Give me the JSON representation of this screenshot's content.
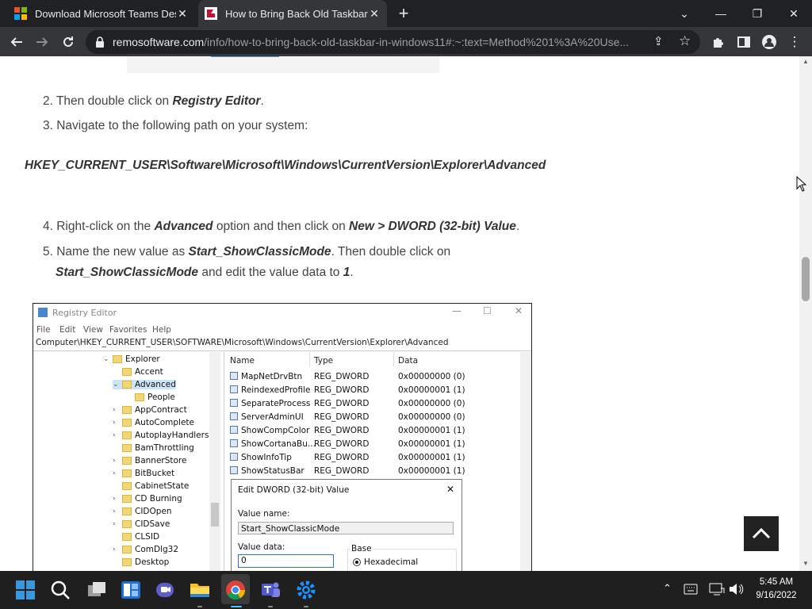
{
  "tabs": [
    {
      "title": "Download Microsoft Teams Desktop",
      "close": "✕"
    },
    {
      "title": "How to Bring Back Old Taskbar in Windows 11",
      "close": "✕"
    }
  ],
  "new_tab": "+",
  "window": {
    "minimize": "—",
    "restore": "❐",
    "close": "✕",
    "tab_search": "⌄"
  },
  "omnibox": {
    "host": "remosoftware.com",
    "path": "/info/how-to-bring-back-old-taskbar-in-windows11#:~:text=Method%201%3A%20Use..."
  },
  "article": {
    "step2_prefix": "2. Then double click on ",
    "step2_bold": "Registry Editor",
    "step2_suffix": ".",
    "step3": "3. Navigate to the following path on your system:",
    "path": "HKEY_CURRENT_USER\\Software\\Microsoft\\Windows\\CurrentVersion\\Explorer\\Advanced",
    "step4_prefix": "4. Right-click on the ",
    "step4_bold1": "Advanced",
    "step4_mid": " option and then click on ",
    "step4_bold2": "New > DWORD (32-bit) Value",
    "step4_suffix": ".",
    "step5_prefix": "5. Name the new value as ",
    "step5_bold1": "Start_ShowClassicMode",
    "step5_mid": ". Then double click on",
    "step5_bold2": "Start_ShowClassicMode",
    "step5_mid2": " and edit the value data to ",
    "step5_bold3": "1",
    "step5_suffix": "."
  },
  "registry": {
    "title": "Registry Editor",
    "menu": [
      "File",
      "Edit",
      "View",
      "Favorites",
      "Help"
    ],
    "address": "Computer\\HKEY_CURRENT_USER\\SOFTWARE\\Microsoft\\Windows\\CurrentVersion\\Explorer\\Advanced",
    "tree": [
      "Explorer",
      "Accent",
      "Advanced",
      "People",
      "AppContract",
      "AutoComplete",
      "AutoplayHandlers",
      "BamThrottling",
      "BannerStore",
      "BitBucket",
      "CabinetState",
      "CD Burning",
      "CIDOpen",
      "CIDSave",
      "CLSID",
      "ComDlg32",
      "Desktop"
    ],
    "columns": [
      "Name",
      "Type",
      "Data"
    ],
    "rows": [
      {
        "name": "MapNetDrvBtn",
        "type": "REG_DWORD",
        "data": "0x00000000 (0)"
      },
      {
        "name": "ReindexedProfile",
        "type": "REG_DWORD",
        "data": "0x00000001 (1)"
      },
      {
        "name": "SeparateProcess",
        "type": "REG_DWORD",
        "data": "0x00000000 (0)"
      },
      {
        "name": "ServerAdminUI",
        "type": "REG_DWORD",
        "data": "0x00000000 (0)"
      },
      {
        "name": "ShowCompColor",
        "type": "REG_DWORD",
        "data": "0x00000001 (1)"
      },
      {
        "name": "ShowCortanaBu...",
        "type": "REG_DWORD",
        "data": "0x00000001 (1)"
      },
      {
        "name": "ShowInfoTip",
        "type": "REG_DWORD",
        "data": "0x00000001 (1)"
      },
      {
        "name": "ShowStatusBar",
        "type": "REG_DWORD",
        "data": "0x00000001 (1)"
      }
    ],
    "dialog": {
      "title": "Edit DWORD (32-bit) Value",
      "value_name_label": "Value name:",
      "value_name": "Start_ShowClassicMode",
      "value_data_label": "Value data:",
      "value_data": "0",
      "base_label": "Base",
      "hex": "Hexadecimal",
      "close": "✕"
    }
  },
  "taskbar": {
    "time": "5:45 AM",
    "date": "9/16/2022"
  },
  "colors": {
    "chrome_dark": "#202124",
    "chrome_toolbar": "#35363a",
    "taskbar": "#1f1f1f",
    "win_blue": "#0078d4"
  }
}
